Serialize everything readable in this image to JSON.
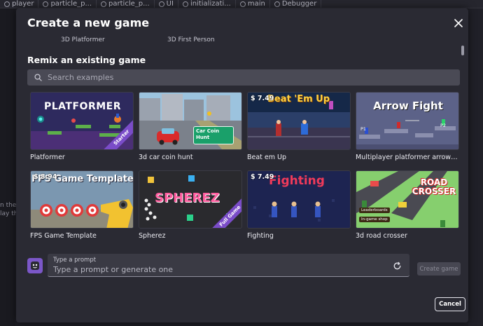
{
  "background": {
    "tabs": [
      "player",
      "particle_p...",
      "particle_p...",
      "UI",
      "initializati...",
      "main",
      "Debugger"
    ],
    "side_texts": [
      "n the",
      "lay th"
    ]
  },
  "modal": {
    "title": "Create a new game",
    "close_icon": "close-icon",
    "partial_labels": [
      "3D Platformer",
      "3D First Person"
    ],
    "section_title": "Remix an existing game",
    "search": {
      "placeholder": "Search examples",
      "icon": "search-icon"
    },
    "games": [
      {
        "title": "Platformer",
        "thumb_text": "PLATFORMER",
        "price": "",
        "ribbon": "Starter"
      },
      {
        "title": "3d car coin hunt",
        "thumb_text": "Car Coin Hunt",
        "price": "",
        "ribbon": ""
      },
      {
        "title": "Beat em Up",
        "thumb_text": "Beat 'Em Up",
        "price": "$ 7.49",
        "ribbon": ""
      },
      {
        "title": "Multiplayer platformer arrow ...",
        "thumb_text": "Arrow Fight",
        "price": "",
        "ribbon": ""
      },
      {
        "title": "FPS Game Template",
        "thumb_text": "FPS Game Template",
        "price": "$ 8.94",
        "ribbon": ""
      },
      {
        "title": "Spherez",
        "thumb_text": "SPHEREZ",
        "price": "",
        "ribbon": "Full Game"
      },
      {
        "title": "Fighting",
        "thumb_text": "Fighting",
        "price": "$ 7.49",
        "ribbon": ""
      },
      {
        "title": "3d road crosser",
        "thumb_text": "ROAD CROSSER",
        "price": "",
        "ribbon": ""
      }
    ],
    "prompt": {
      "label": "Type a prompt",
      "placeholder": "Type a prompt or generate one",
      "refresh_icon": "refresh-icon"
    },
    "create_label": "Create game",
    "cancel_label": "Cancel"
  },
  "thumb_extras": {
    "arrow_fight_p1": "P1",
    "arrow_fight_p2": "P2",
    "road_leaderboards": "Leaderboards",
    "road_shop": "In-game shop"
  }
}
